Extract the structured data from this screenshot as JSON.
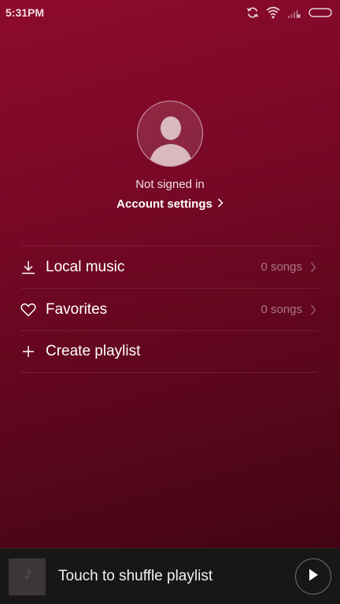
{
  "status_bar": {
    "time": "5:31PM",
    "icons": [
      "sync-icon",
      "wifi-icon",
      "signal-icon",
      "battery-icon"
    ]
  },
  "profile": {
    "avatar_icon": "user-silhouette-icon",
    "status_text": "Not signed in",
    "account_link": "Account settings"
  },
  "menu": {
    "items": [
      {
        "icon": "download-icon",
        "label": "Local music",
        "count": "0 songs"
      },
      {
        "icon": "heart-icon",
        "label": "Favorites",
        "count": "0 songs"
      },
      {
        "icon": "plus-icon",
        "label": "Create playlist",
        "count": ""
      }
    ]
  },
  "player": {
    "album_icon": "music-note-icon",
    "text": "Touch to shuffle playlist",
    "play_icon": "play-icon"
  },
  "colors": {
    "background_top": "#8e0a2c",
    "background_bottom": "#3a0412",
    "player_background": "#191616"
  }
}
